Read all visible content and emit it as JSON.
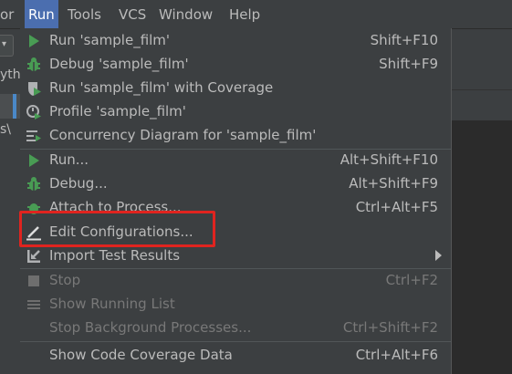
{
  "menubar": {
    "items": [
      "or",
      "Run",
      "Tools",
      "VCS",
      "Window",
      "Help"
    ],
    "active": "Run"
  },
  "left": {
    "partial_text_1": "yth",
    "partial_text_2": "s\\"
  },
  "run_menu": {
    "items": [
      {
        "label": "Run 'sample_film'",
        "shortcut": "Shift+F10",
        "icon": "run-icon"
      },
      {
        "label": "Debug 'sample_film'",
        "shortcut": "Shift+F9",
        "icon": "debug-icon"
      },
      {
        "label": "Run 'sample_film' with Coverage",
        "shortcut": "",
        "icon": "coverage-icon"
      },
      {
        "label": "Profile 'sample_film'",
        "shortcut": "",
        "icon": "profile-icon"
      },
      {
        "label": "Concurrency Diagram for 'sample_film'",
        "shortcut": "",
        "icon": "concurrency-icon"
      },
      {
        "label": "Run...",
        "shortcut": "Alt+Shift+F10",
        "icon": "run-icon"
      },
      {
        "label": "Debug...",
        "shortcut": "Alt+Shift+F9",
        "icon": "debug-icon"
      },
      {
        "label": "Attach to Process...",
        "shortcut": "Ctrl+Alt+F5",
        "icon": "attach-icon"
      },
      {
        "label": "Edit Configurations...",
        "shortcut": "",
        "icon": "edit-icon"
      },
      {
        "label": "Import Test Results",
        "shortcut": "",
        "icon": "import-icon"
      },
      {
        "label": "Stop",
        "shortcut": "Ctrl+F2",
        "icon": "stop-icon"
      },
      {
        "label": "Show Running List",
        "shortcut": "",
        "icon": "list-icon"
      },
      {
        "label": "Stop Background Processes...",
        "shortcut": "Ctrl+Shift+F2",
        "icon": ""
      },
      {
        "label": "Show Code Coverage Data",
        "shortcut": "Ctrl+Alt+F6",
        "icon": ""
      }
    ]
  },
  "colors": {
    "menu_bg": "#3c3f41",
    "active_menu": "#4b6eaf",
    "run_green": "#499c54",
    "highlight_red": "#e0241f"
  }
}
